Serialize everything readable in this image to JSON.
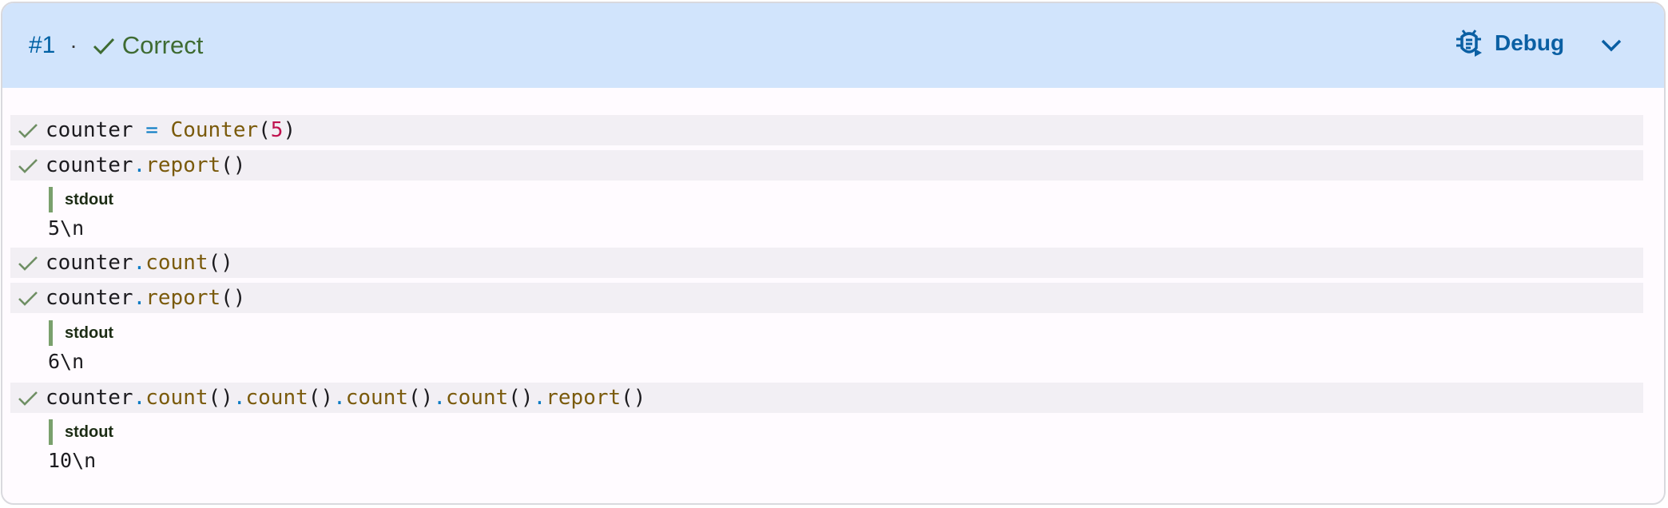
{
  "header": {
    "id_label": "#1",
    "separator": "·",
    "status": "Correct",
    "debug_label": "Debug"
  },
  "colors": {
    "header_bg": "#d1e4fc",
    "correct_green": "#3e6b32",
    "accent_blue": "#0061a4",
    "row_bg": "#f2eff4",
    "stdout_bar": "#7aa06d"
  },
  "rows": [
    {
      "tokens": [
        {
          "t": "counter ",
          "c": ""
        },
        {
          "t": "=",
          "c": "op"
        },
        {
          "t": " ",
          "c": ""
        },
        {
          "t": "Counter",
          "c": "fn"
        },
        {
          "t": "(",
          "c": ""
        },
        {
          "t": "5",
          "c": "num"
        },
        {
          "t": ")",
          "c": ""
        }
      ]
    },
    {
      "tokens": [
        {
          "t": "counter",
          "c": ""
        },
        {
          "t": ".",
          "c": "op"
        },
        {
          "t": "report",
          "c": "fn"
        },
        {
          "t": "()",
          "c": ""
        }
      ],
      "stdout_label": "stdout",
      "stdout": "5\\n"
    },
    {
      "tokens": [
        {
          "t": "counter",
          "c": ""
        },
        {
          "t": ".",
          "c": "op"
        },
        {
          "t": "count",
          "c": "fn"
        },
        {
          "t": "()",
          "c": ""
        }
      ]
    },
    {
      "tokens": [
        {
          "t": "counter",
          "c": ""
        },
        {
          "t": ".",
          "c": "op"
        },
        {
          "t": "report",
          "c": "fn"
        },
        {
          "t": "()",
          "c": ""
        }
      ],
      "stdout_label": "stdout",
      "stdout": "6\\n"
    },
    {
      "tokens": [
        {
          "t": "counter",
          "c": ""
        },
        {
          "t": ".",
          "c": "op"
        },
        {
          "t": "count",
          "c": "fn"
        },
        {
          "t": "()",
          "c": ""
        },
        {
          "t": ".",
          "c": "op"
        },
        {
          "t": "count",
          "c": "fn"
        },
        {
          "t": "()",
          "c": ""
        },
        {
          "t": ".",
          "c": "op"
        },
        {
          "t": "count",
          "c": "fn"
        },
        {
          "t": "()",
          "c": ""
        },
        {
          "t": ".",
          "c": "op"
        },
        {
          "t": "count",
          "c": "fn"
        },
        {
          "t": "()",
          "c": ""
        },
        {
          "t": ".",
          "c": "op"
        },
        {
          "t": "report",
          "c": "fn"
        },
        {
          "t": "()",
          "c": ""
        }
      ],
      "stdout_label": "stdout",
      "stdout": "10\\n"
    }
  ]
}
